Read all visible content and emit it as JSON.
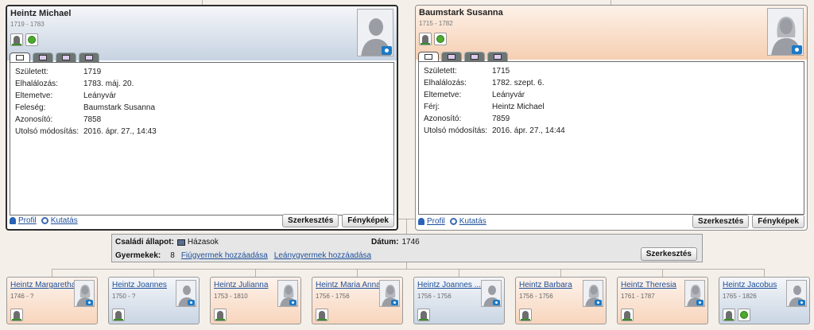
{
  "father": {
    "name": "Heintz Michael",
    "dates": "1719 - 1783",
    "facts": [
      {
        "label": "Született:",
        "value": "1719"
      },
      {
        "label": "Elhalálozás:",
        "value": "1783. máj. 20."
      },
      {
        "label": "Eltemetve:",
        "value": "Leányvár"
      },
      {
        "label": "Feleség:",
        "value": "Baumstark Susanna"
      },
      {
        "label": "Azonosító:",
        "value": "7858"
      },
      {
        "label": "Utolsó módosítás:",
        "value": "2016. ápr. 27., 14:43"
      }
    ]
  },
  "mother": {
    "name": "Baumstark Susanna",
    "dates": "1715 - 1782",
    "facts": [
      {
        "label": "Született:",
        "value": "1715"
      },
      {
        "label": "Elhalálozás:",
        "value": "1782. szept. 6."
      },
      {
        "label": "Eltemetve:",
        "value": "Leányvár"
      },
      {
        "label": "Férj:",
        "value": "Heintz Michael"
      },
      {
        "label": "Azonosító:",
        "value": "7859"
      },
      {
        "label": "Utolsó módosítás:",
        "value": "2016. ápr. 27., 14:44"
      }
    ]
  },
  "links": {
    "profile": "Profil",
    "research": "Kutatás"
  },
  "buttons": {
    "edit": "Szerkesztés",
    "photos": "Fényképek"
  },
  "family": {
    "status_label": "Családi állapot:",
    "status_value": "Házasok",
    "date_label": "Dátum:",
    "date_value": "1746",
    "children_label": "Gyermekek:",
    "children_count": "8",
    "add_son": "Fiúgyermek hozzáadása",
    "add_daughter": "Leánygyermek hozzáadása"
  },
  "children": [
    {
      "name": "Heintz Margaretha",
      "dates": "1746 - ?"
    },
    {
      "name": "Heintz Joannes",
      "dates": "1750 - ?"
    },
    {
      "name": "Heintz Julianna",
      "dates": "1753 - 1810"
    },
    {
      "name": "Heintz Maria Anna",
      "dates": "1756 - 1756"
    },
    {
      "name": "Heintz Joannes ...",
      "dates": "1756 - 1756"
    },
    {
      "name": "Heintz Barbara",
      "dates": "1756 - 1756"
    },
    {
      "name": "Heintz Theresia",
      "dates": "1761 - 1787"
    },
    {
      "name": "Heintz Jacobus",
      "dates": "1765 - 1826"
    }
  ],
  "colors": {
    "male": "#c7d3e2",
    "female": "#f6cfb2",
    "link": "#1e4f9a"
  }
}
